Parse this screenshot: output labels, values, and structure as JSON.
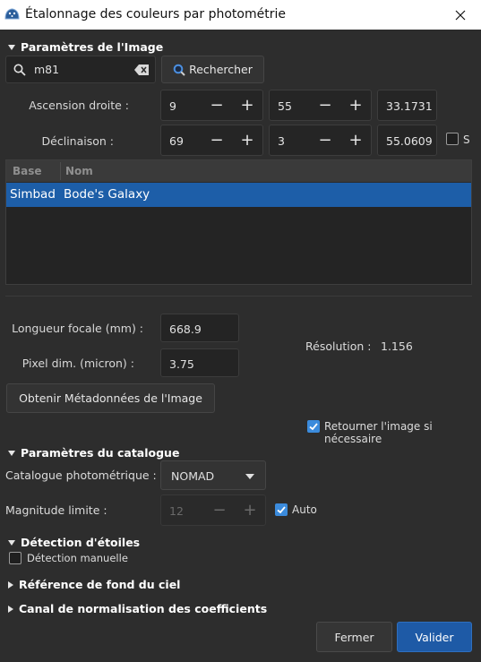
{
  "window": {
    "title": "Étalonnage des couleurs par photométrie"
  },
  "image_params": {
    "header": "Paramètres de l'Image",
    "search_value": "m81",
    "search_button": "Rechercher",
    "ra_label": "Ascension droite :",
    "ra_h": "9",
    "ra_m": "55",
    "ra_s": "33.1731",
    "dec_label": "Déclinaison :",
    "dec_d": "69",
    "dec_m": "3",
    "dec_s": "55.0609",
    "south_label": "S",
    "table": {
      "columns": [
        "Base",
        "Nom"
      ],
      "rows": [
        {
          "base": "Simbad",
          "name": "Bode's Galaxy"
        }
      ]
    },
    "focal_label": "Longueur focale (mm) :",
    "focal_value": "668.9",
    "pixel_label": "Pixel dim. (micron) :",
    "pixel_value": "3.75",
    "resolution_label": "Résolution :",
    "resolution_value": "1.156",
    "metadata_button": "Obtenir Métadonnées de l'Image",
    "flip_label": "Retourner l'image si nécessaire"
  },
  "catalog_params": {
    "header": "Paramètres du catalogue",
    "catalog_label": "Catalogue photométrique :",
    "catalog_value": "NOMAD",
    "mag_label": "Magnitude limite :",
    "mag_value": "12",
    "auto_label": "Auto"
  },
  "star_detection": {
    "header": "Détection d'étoiles",
    "manual_label": "Détection manuelle"
  },
  "sky_bg": {
    "header": "Référence de fond du ciel"
  },
  "coef_norm": {
    "header": "Canal de normalisation des coefficients"
  },
  "footer": {
    "close": "Fermer",
    "ok": "Valider"
  },
  "colors": {
    "accent": "#3b8bdc",
    "selection": "#1d5ea8",
    "primary_button": "#1e5aa6"
  }
}
